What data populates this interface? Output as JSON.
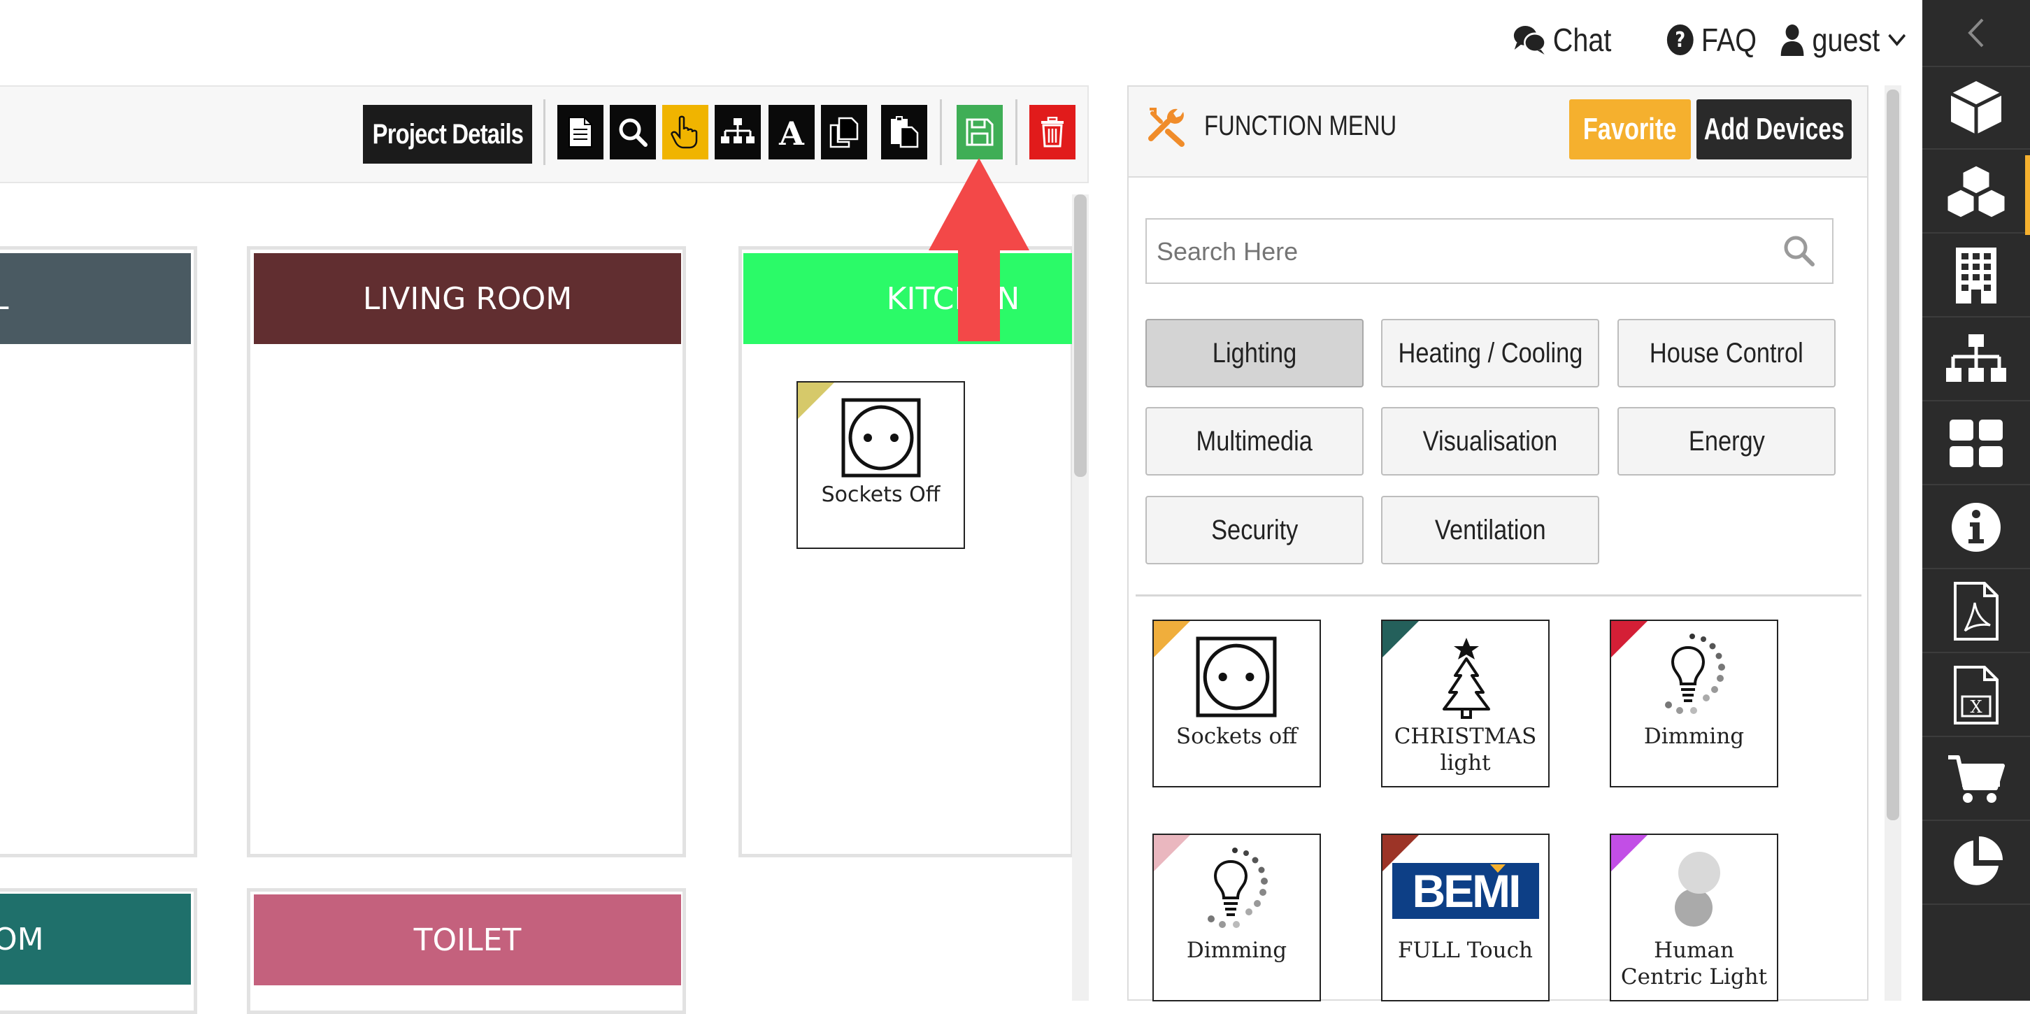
{
  "topnav": {
    "chat_label": "Chat",
    "faq_label": "FAQ",
    "user_label": "guest"
  },
  "toolbar": {
    "project_details_label": "Project Details"
  },
  "rooms": [
    {
      "name": "L",
      "color": "#4a5a62"
    },
    {
      "name": "LIVING ROOM",
      "color": "#612e30"
    },
    {
      "name": "KITCHEN",
      "color": "#2bfa68"
    },
    {
      "name": "OM",
      "color": "#1f706b"
    },
    {
      "name": "TOILET",
      "color": "#c4617d"
    }
  ],
  "placed_devices": [
    {
      "label": "Sockets Off",
      "room": "KITCHEN",
      "corner_color": "#d6c96a"
    }
  ],
  "function_menu": {
    "title": "FUNCTION MENU",
    "favorite_label": "Favorite",
    "add_devices_label": "Add Devices",
    "search_placeholder": "Search Here",
    "categories": [
      "Lighting",
      "Heating / Cooling",
      "House Control",
      "Multimedia",
      "Visualisation",
      "Energy",
      "Security",
      "Ventilation"
    ],
    "active_category": "Lighting",
    "devices": [
      {
        "label": "Sockets off",
        "icon": "socket-icon",
        "corner_color": "#f0ae3c"
      },
      {
        "label": "CHRISTMAS light",
        "icon": "christmas-tree-icon",
        "corner_color": "#24605b"
      },
      {
        "label": "Dimming",
        "icon": "dimming-bulb-icon",
        "corner_color": "#d41f36"
      },
      {
        "label": "Dimming",
        "icon": "dimming-bulb-icon",
        "corner_color": "#eab7bf"
      },
      {
        "label": "FULL Touch",
        "icon": "bemi-logo",
        "corner_color": "#9c3427",
        "logo_text": "BEMI"
      },
      {
        "label": "Human Centric Light",
        "icon": "human-centric-light-icon",
        "corner_color": "#c24ee6"
      }
    ]
  },
  "colors": {
    "accent_orange": "#f5b02e",
    "save_green": "#3fae56",
    "delete_red": "#e11b1b",
    "highlight_yellow": "#f0b400",
    "arrow_red": "#f34848"
  }
}
